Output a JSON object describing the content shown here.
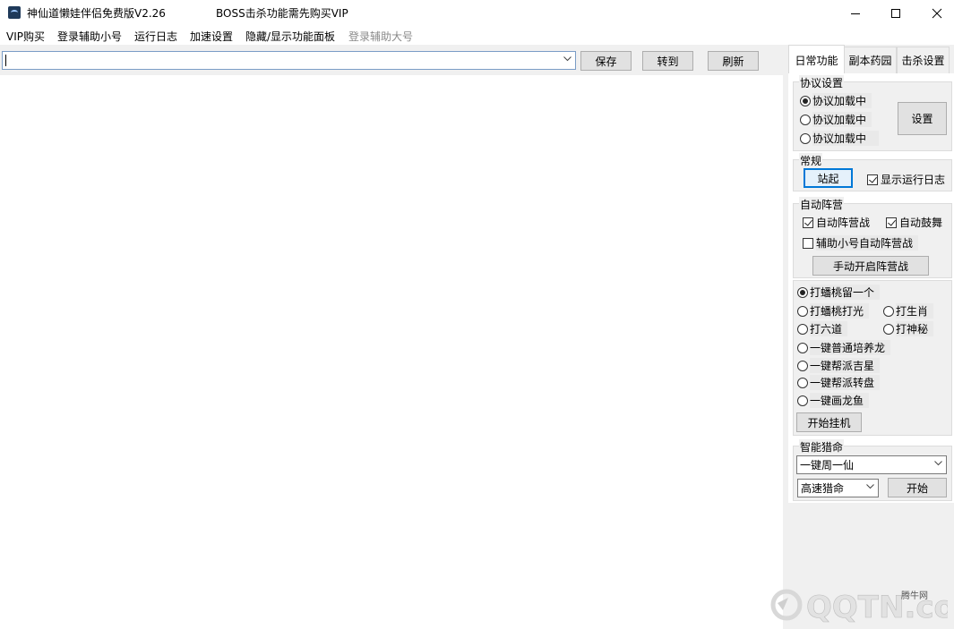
{
  "window": {
    "title": "神仙道懒娃伴侣免费版V2.26",
    "notice": "BOSS击杀功能需先购买VIP"
  },
  "menu": [
    "VIP购买",
    "登录辅助小号",
    "运行日志",
    "加速设置",
    "隐藏/显示功能面板",
    "登录辅助大号"
  ],
  "toolbar": {
    "url_value": "",
    "save_label": "保存",
    "goto_label": "转到",
    "refresh_label": "刷新"
  },
  "tabs": [
    "日常功能",
    "副本药园",
    "击杀设置"
  ],
  "protocol": {
    "title": "协议设置",
    "options": [
      "协议加载中",
      "协议加载中",
      "协议加载中"
    ],
    "selected": 0,
    "settings_label": "设置"
  },
  "general": {
    "title": "常规",
    "stand_label": "站起",
    "show_log_label": "显示运行日志",
    "show_log_checked": true
  },
  "camp": {
    "title": "自动阵营",
    "auto_camp_label": "自动阵营战",
    "auto_camp_checked": true,
    "auto_drum_label": "自动鼓舞",
    "auto_drum_checked": true,
    "alt_camp_label": "辅助小号自动阵营战",
    "alt_camp_checked": false,
    "manual_label": "手动开启阵营战"
  },
  "tasks": {
    "options": [
      "打蟠桃留一个",
      "打蟠桃打光",
      "打生肖",
      "打六道",
      "打神秘",
      "一键普通培养龙",
      "一键帮派吉星",
      "一键帮派转盘",
      "一键画龙鱼"
    ],
    "selected": 0,
    "start_label": "开始挂机"
  },
  "hunt": {
    "title": "智能猎命",
    "target_value": "一键周一仙",
    "mode_value": "高速猎命",
    "start_label": "开始"
  },
  "watermark": {
    "logo_text": "QQTN.com",
    "site_label": "腾牛网"
  }
}
